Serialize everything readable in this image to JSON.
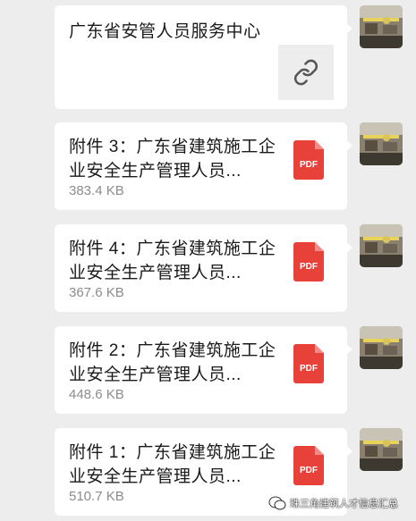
{
  "link_message": {
    "title": "广东省安管人员服务中心",
    "icon": "link-icon"
  },
  "files": [
    {
      "name": "附件 3：广东省建筑施工企业安全生产管理人员...",
      "size": "383.4 KB",
      "icon": "PDF"
    },
    {
      "name": "附件 4：广东省建筑施工企业安全生产管理人员...",
      "size": "367.6 KB",
      "icon": "PDF"
    },
    {
      "name": "附件 2：广东省建筑施工企业安全生产管理人员...",
      "size": "448.6 KB",
      "icon": "PDF"
    },
    {
      "name": "附件 1：广东省建筑施工企业安全生产管理人员...",
      "size": "510.7 KB",
      "icon": "PDF"
    }
  ],
  "watermark": {
    "text": "珠三角建筑人才信息汇总"
  },
  "colors": {
    "background": "#ededed",
    "bubble": "#ffffff",
    "pdf": "#e8413a",
    "size_text": "#8c8c8c"
  }
}
